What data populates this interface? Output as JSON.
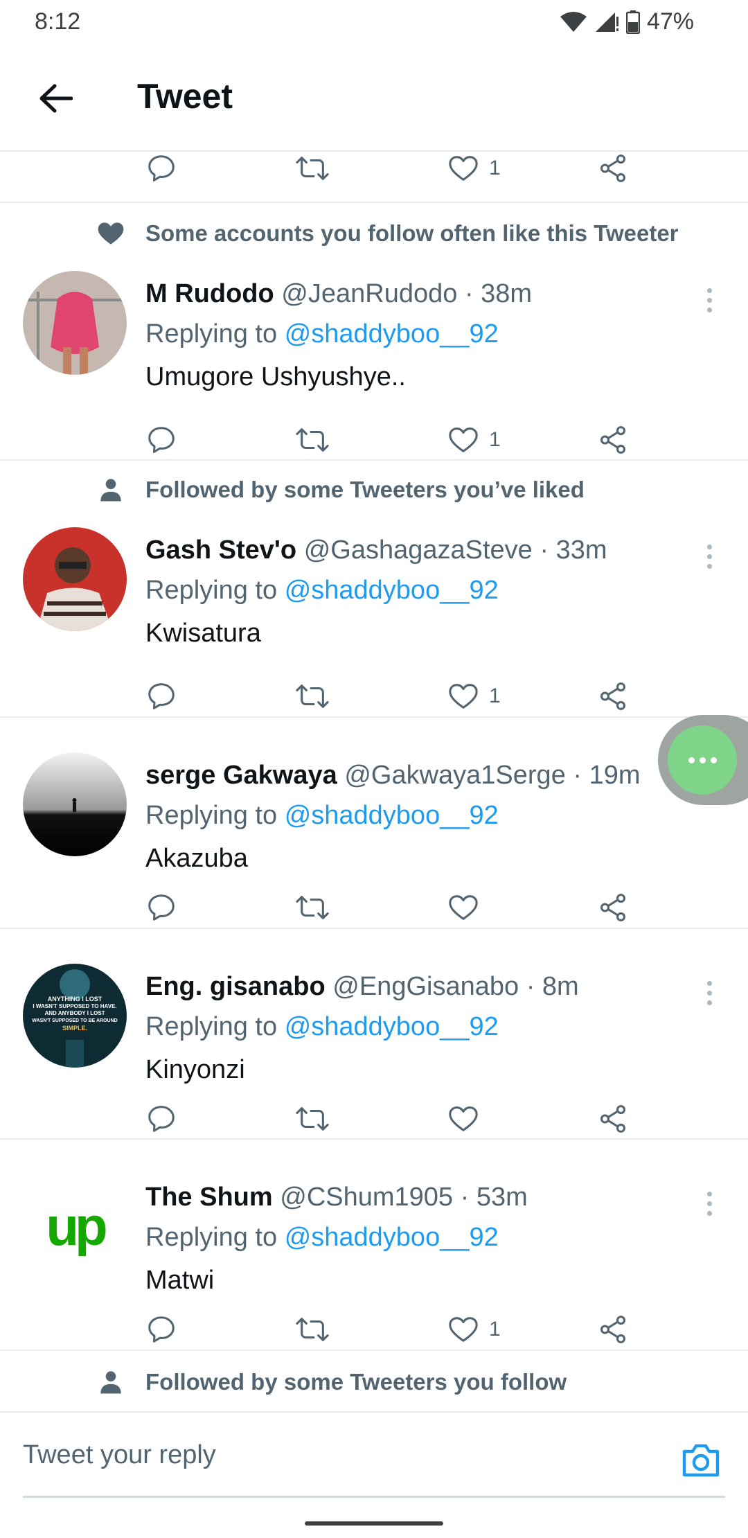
{
  "status_bar": {
    "time": "8:12",
    "battery": "47%"
  },
  "header": {
    "title": "Tweet"
  },
  "top_actions": {
    "like_count": "1"
  },
  "tweets": [
    {
      "context": "Some accounts you follow often like this Tweeter",
      "context_icon": "heart-icon",
      "name": "M Rudodo",
      "handle": "@JeanRudodo",
      "time": "· 38m",
      "replying_prefix": "Replying to",
      "mention": "@shaddyboo__92",
      "text": "Umugore Ushyushye..",
      "like_count": "1",
      "avatar_colors": {
        "bg": "#c4b8b0",
        "fg": "#e0456d"
      }
    },
    {
      "context": "Followed by some Tweeters you’ve liked",
      "context_icon": "person-icon",
      "name": "Gash Stev'o",
      "handle": "@GashagazaSteve",
      "time": "· 33m",
      "replying_prefix": "Replying to",
      "mention": "@shaddyboo__92",
      "text": "Kwisatura",
      "like_count": "1",
      "avatar_colors": {
        "bg": "#c8322a",
        "fg": "#5a3a2a"
      }
    },
    {
      "context": "",
      "name": "serge Gakwaya",
      "handle": "@Gakwaya1Serge",
      "time": "· 19m",
      "replying_prefix": "Replying to",
      "mention": "@shaddyboo__92",
      "text": "Akazuba",
      "like_count": "",
      "avatar_colors": {
        "bg": "#111111",
        "fg": "#cccccc"
      }
    },
    {
      "context": "",
      "name": "Eng. gisanabo",
      "handle": "@EngGisanabo",
      "time": "· 8m",
      "replying_prefix": "Replying to",
      "mention": "@shaddyboo__92",
      "text": "Kinyonzi",
      "like_count": "",
      "avatar_colors": {
        "bg": "#0e2a33",
        "fg": "#ffffff"
      },
      "avatar_lines": [
        "ANYTHING I LOST",
        "I WASN'T SUPPOSED TO HAVE.",
        "AND ANYBODY I LOST",
        "WASN'T SUPPOSED TO BE AROUND",
        "SIMPLE."
      ]
    },
    {
      "context": "",
      "name": "The Shum",
      "handle": "@CShum1905",
      "time": "· 53m",
      "replying_prefix": "Replying to",
      "mention": "@shaddyboo__92",
      "text": "Matwi",
      "like_count": "1",
      "avatar_colors": {
        "bg": "#ffffff",
        "fg": "#14a800"
      },
      "avatar_logo": "up"
    }
  ],
  "bottom_context": {
    "text": "Followed by some Tweeters you follow",
    "icon": "person-icon"
  },
  "composer": {
    "placeholder": "Tweet your reply"
  },
  "colors": {
    "accent": "#1d9bf0",
    "muted": "#536471",
    "divider": "#e6ecf0"
  }
}
